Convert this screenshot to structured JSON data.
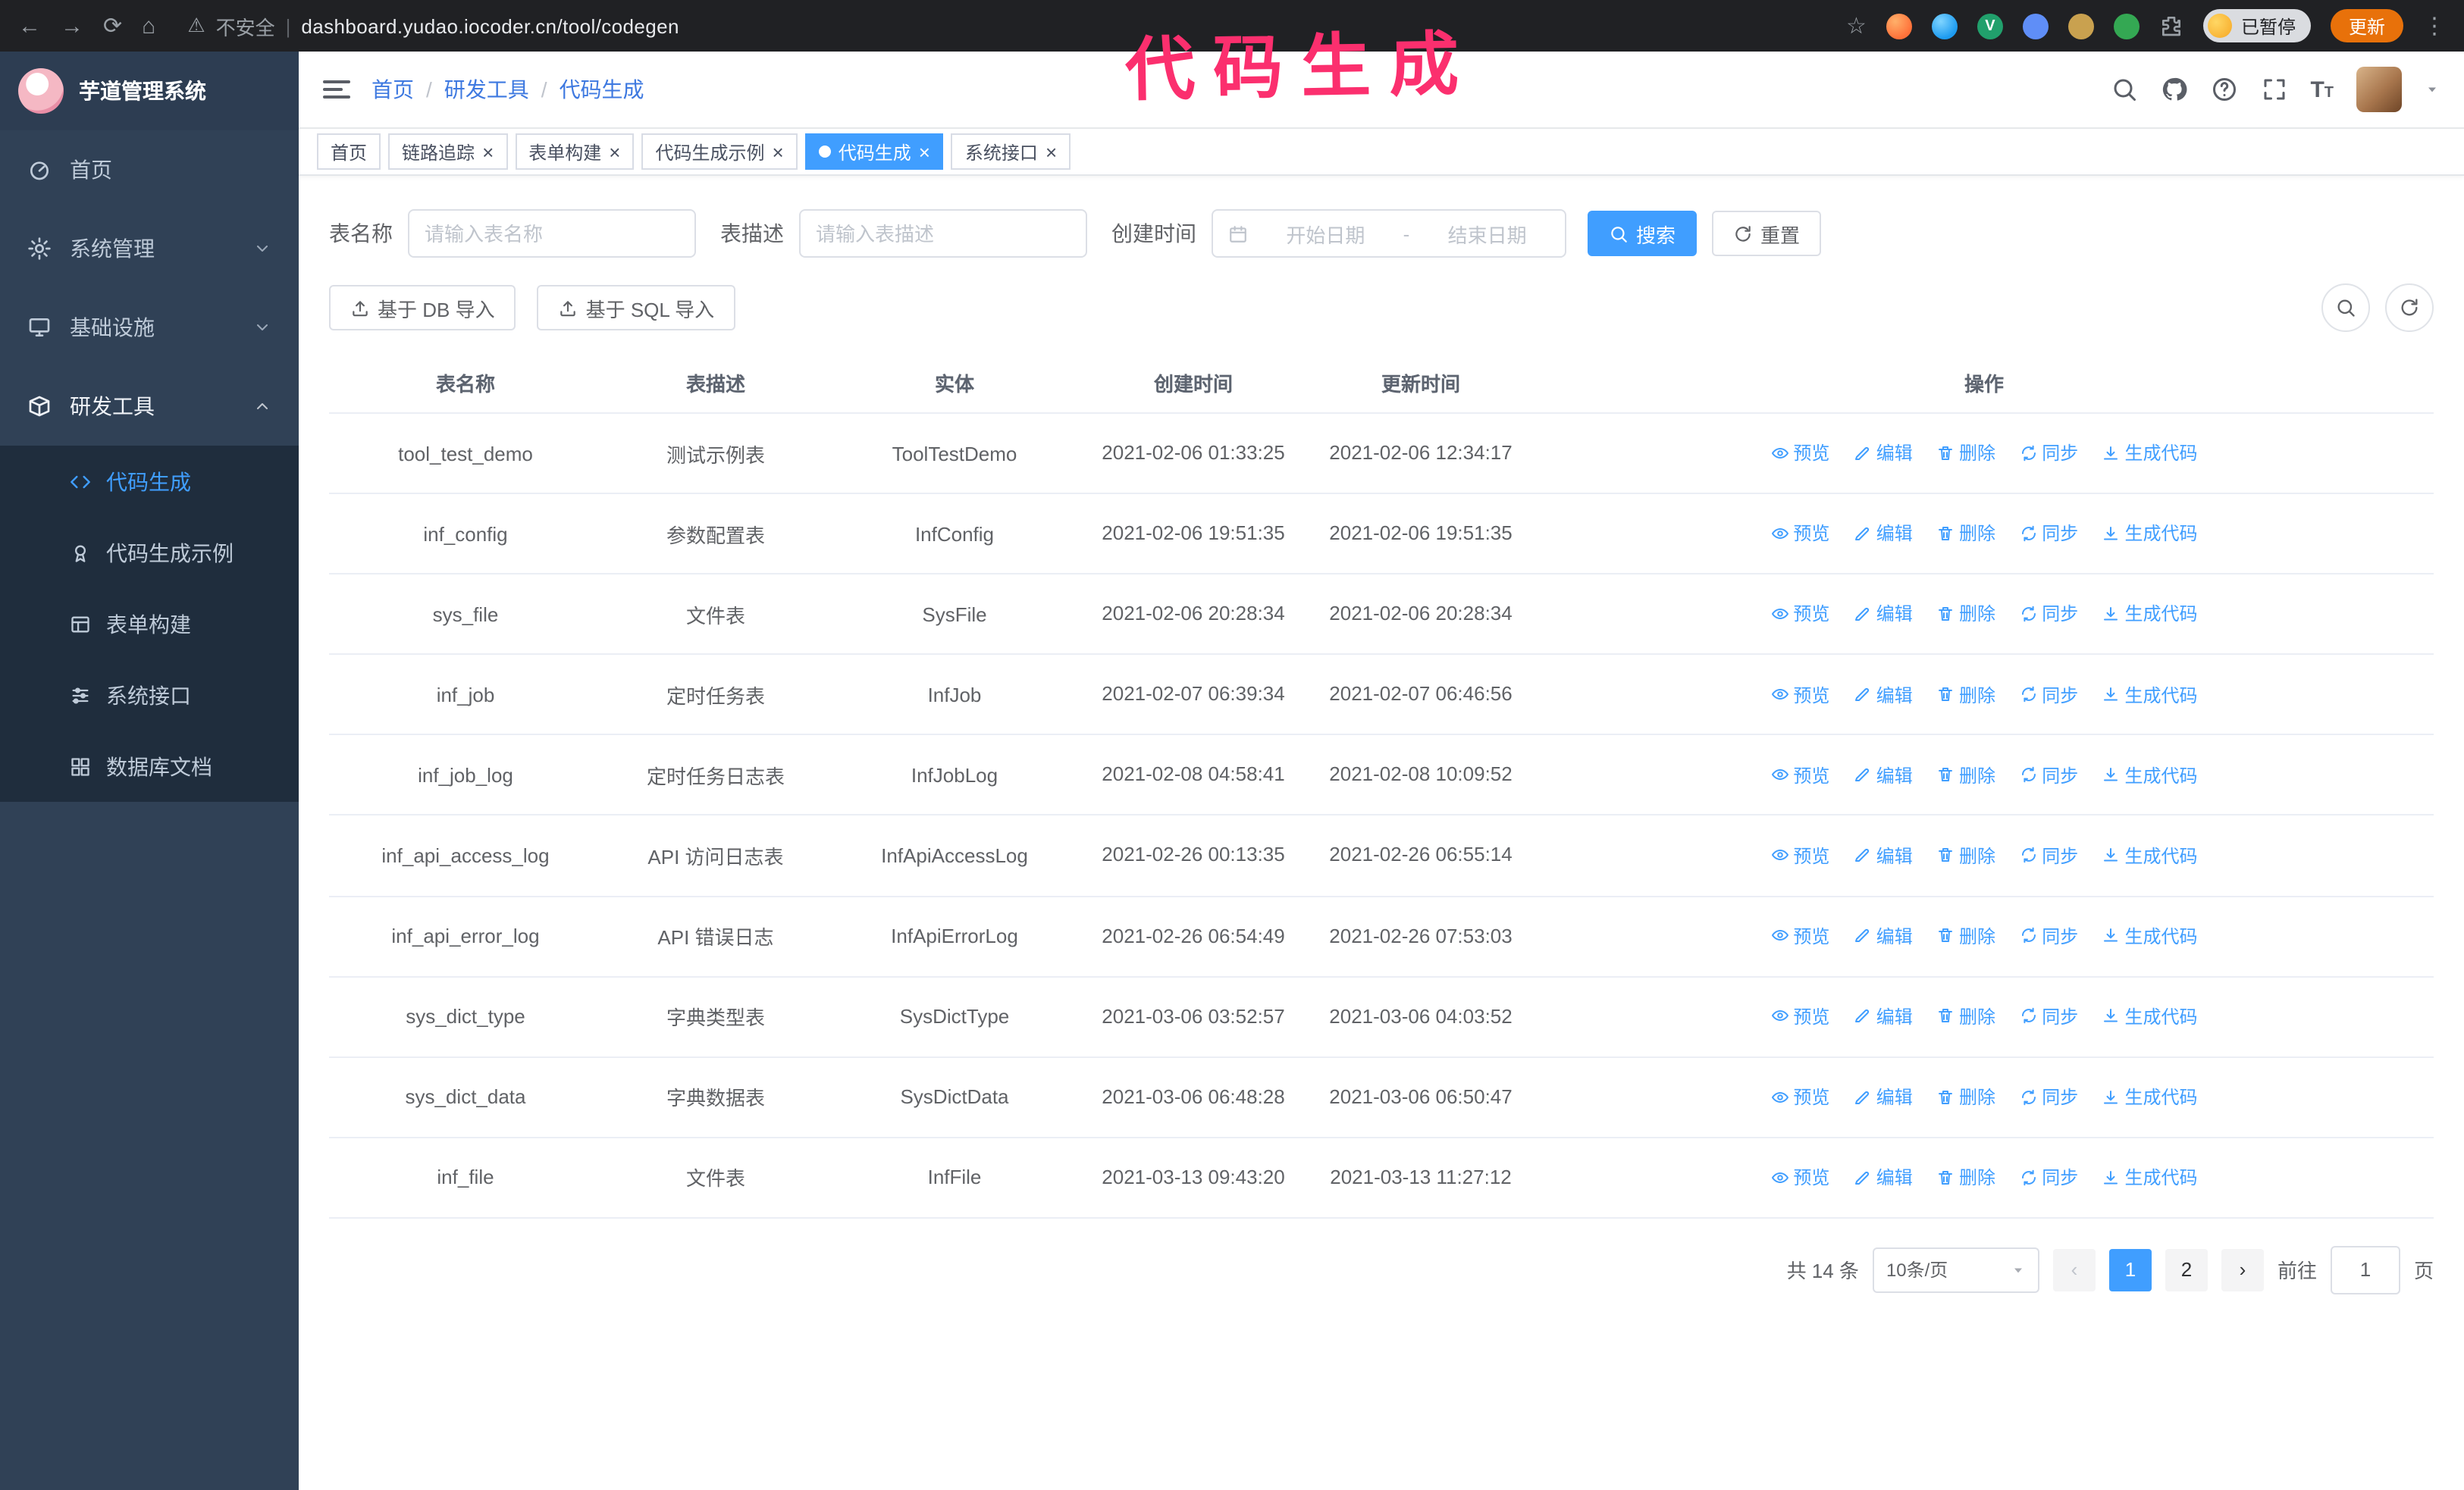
{
  "browser": {
    "icons": {
      "back": "←",
      "forward": "→",
      "reload": "⟳",
      "home": "⌂",
      "warning": "⚠",
      "star": "☆",
      "kebab": "⋮",
      "divider": "|"
    },
    "security_label": "不安全",
    "url": "dashboard.yudao.iocoder.cn/tool/codegen",
    "extensions": {
      "vue_badge": "V"
    },
    "paused_badge": "已暂停",
    "update_button": "更新"
  },
  "annotation": "代码生成",
  "icons": {
    "close": "×",
    "font_large": "T",
    "font_small": "T"
  },
  "sidebar": {
    "logo_title": "芋道管理系统",
    "items": [
      {
        "label": "首页"
      },
      {
        "label": "系统管理"
      },
      {
        "label": "基础设施"
      },
      {
        "label": "研发工具"
      }
    ],
    "sub_items": [
      {
        "label": "代码生成"
      },
      {
        "label": "代码生成示例"
      },
      {
        "label": "表单构建"
      },
      {
        "label": "系统接口"
      },
      {
        "label": "数据库文档"
      }
    ]
  },
  "header": {
    "breadcrumb": [
      "首页",
      "研发工具",
      "代码生成"
    ],
    "separator": "/"
  },
  "tabs": [
    {
      "label": "首页"
    },
    {
      "label": "链路追踪"
    },
    {
      "label": "表单构建"
    },
    {
      "label": "代码生成示例"
    },
    {
      "label": "代码生成"
    },
    {
      "label": "系统接口"
    }
  ],
  "filters": {
    "table_name_label": "表名称",
    "table_name_placeholder": "请输入表名称",
    "table_desc_label": "表描述",
    "table_desc_placeholder": "请输入表描述",
    "create_time_label": "创建时间",
    "start_date_placeholder": "开始日期",
    "range_separator": "-",
    "end_date_placeholder": "结束日期",
    "search_button": "搜索",
    "reset_button": "重置"
  },
  "toolbar": {
    "import_db_button": "基于 DB 导入",
    "import_sql_button": "基于 SQL 导入"
  },
  "table": {
    "columns": [
      "表名称",
      "表描述",
      "实体",
      "创建时间",
      "更新时间",
      "操作"
    ],
    "actions": [
      "预览",
      "编辑",
      "删除",
      "同步",
      "生成代码"
    ],
    "rows": [
      {
        "name": "tool_test_demo",
        "desc": "测试示例表",
        "entity": "ToolTestDemo",
        "created": "2021-02-06 01:33:25",
        "updated": "2021-02-06 12:34:17"
      },
      {
        "name": "inf_config",
        "desc": "参数配置表",
        "entity": "InfConfig",
        "created": "2021-02-06 19:51:35",
        "updated": "2021-02-06 19:51:35"
      },
      {
        "name": "sys_file",
        "desc": "文件表",
        "entity": "SysFile",
        "created": "2021-02-06 20:28:34",
        "updated": "2021-02-06 20:28:34"
      },
      {
        "name": "inf_job",
        "desc": "定时任务表",
        "entity": "InfJob",
        "created": "2021-02-07 06:39:34",
        "updated": "2021-02-07 06:46:56"
      },
      {
        "name": "inf_job_log",
        "desc": "定时任务日志表",
        "entity": "InfJobLog",
        "created": "2021-02-08 04:58:41",
        "updated": "2021-02-08 10:09:52"
      },
      {
        "name": "inf_api_access_log",
        "desc": "API 访问日志表",
        "entity": "InfApiAccessLog",
        "created": "2021-02-26 00:13:35",
        "updated": "2021-02-26 06:55:14"
      },
      {
        "name": "inf_api_error_log",
        "desc": "API 错误日志",
        "entity": "InfApiErrorLog",
        "created": "2021-02-26 06:54:49",
        "updated": "2021-02-26 07:53:03"
      },
      {
        "name": "sys_dict_type",
        "desc": "字典类型表",
        "entity": "SysDictType",
        "created": "2021-03-06 03:52:57",
        "updated": "2021-03-06 04:03:52"
      },
      {
        "name": "sys_dict_data",
        "desc": "字典数据表",
        "entity": "SysDictData",
        "created": "2021-03-06 06:48:28",
        "updated": "2021-03-06 06:50:47"
      },
      {
        "name": "inf_file",
        "desc": "文件表",
        "entity": "InfFile",
        "created": "2021-03-13 09:43:20",
        "updated": "2021-03-13 11:27:12"
      }
    ]
  },
  "pagination": {
    "total": "共 14 条",
    "page_size": "10条/页",
    "prev": "‹",
    "next": "›",
    "pages": [
      "1",
      "2"
    ],
    "goto_label": "前往",
    "goto_value": "1",
    "unit_label": "页"
  },
  "colors": {
    "accent": "#409eff",
    "sidebar": "#304156",
    "annotation": "#fb2f6e"
  }
}
